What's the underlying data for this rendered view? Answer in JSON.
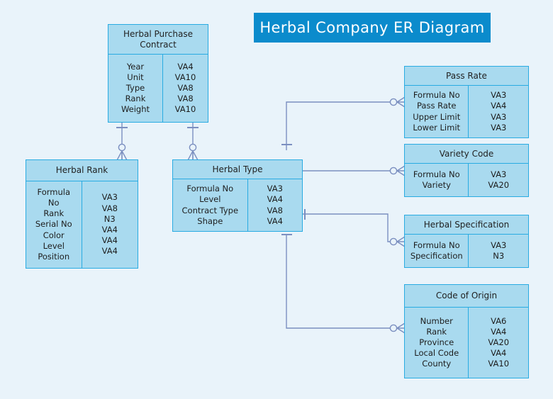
{
  "diagram": {
    "title": "Herbal Company ER Diagram",
    "colors": {
      "background": "#e9f3fa",
      "banner": "#0b8bcc",
      "banner_text": "#ffffff",
      "entity_fill": "#a9daef",
      "entity_border": "#29abe2",
      "connector": "#7b8fc0"
    }
  },
  "entities": {
    "herbal_purchase_contract": {
      "name": "Herbal Purchase\nContract",
      "attributes": [
        "Year",
        "Unit",
        "Type",
        "Rank",
        "Weight"
      ],
      "types": [
        "VA4",
        "VA10",
        "VA8",
        "VA8",
        "VA10"
      ]
    },
    "herbal_rank": {
      "name": "Herbal Rank",
      "attributes": [
        "Formula\nNo",
        "Rank",
        "Serial No",
        "Color",
        "Level",
        "Position"
      ],
      "types": [
        "VA3",
        "VA8",
        "N3",
        "VA4",
        "VA4",
        "VA4"
      ]
    },
    "herbal_type": {
      "name": "Herbal Type",
      "attributes": [
        "Formula No",
        "Level",
        "Contract Type",
        "Shape"
      ],
      "types": [
        "VA3",
        "VA4",
        "VA8",
        "VA4"
      ]
    },
    "pass_rate": {
      "name": "Pass Rate",
      "attributes": [
        "Formula No",
        "Pass Rate",
        "Upper Limit",
        "Lower Limit"
      ],
      "types": [
        "VA3",
        "VA4",
        "VA3",
        "VA3"
      ]
    },
    "variety_code": {
      "name": "Variety Code",
      "attributes": [
        "Formula No",
        "Variety"
      ],
      "types": [
        "VA3",
        "VA20"
      ]
    },
    "herbal_specification": {
      "name": "Herbal Specification",
      "attributes": [
        "Formula No",
        "Specification"
      ],
      "types": [
        "VA3",
        "N3"
      ]
    },
    "code_of_origin": {
      "name": "Code of Origin",
      "attributes": [
        "Number",
        "Rank",
        "Province",
        "Local Code",
        "County"
      ],
      "types": [
        "VA6",
        "VA4",
        "VA20",
        "VA4",
        "VA10"
      ]
    }
  },
  "relationships": [
    {
      "name": "contract-to-rank",
      "from": "herbal_purchase_contract",
      "to": "herbal_rank",
      "from_cardinality": "one",
      "to_cardinality": "zero-or-many"
    },
    {
      "name": "contract-to-type",
      "from": "herbal_purchase_contract",
      "to": "herbal_type",
      "from_cardinality": "one",
      "to_cardinality": "zero-or-many"
    },
    {
      "name": "type-to-pass-rate",
      "from": "herbal_type",
      "to": "pass_rate",
      "from_cardinality": "one",
      "to_cardinality": "zero-or-many"
    },
    {
      "name": "type-to-variety-code",
      "from": "herbal_type",
      "to": "variety_code",
      "from_cardinality": "one",
      "to_cardinality": "zero-or-many"
    },
    {
      "name": "type-to-herbal-specification",
      "from": "herbal_type",
      "to": "herbal_specification",
      "from_cardinality": "one",
      "to_cardinality": "zero-or-many"
    },
    {
      "name": "type-to-code-of-origin",
      "from": "herbal_type",
      "to": "code_of_origin",
      "from_cardinality": "one",
      "to_cardinality": "zero-or-many"
    }
  ]
}
